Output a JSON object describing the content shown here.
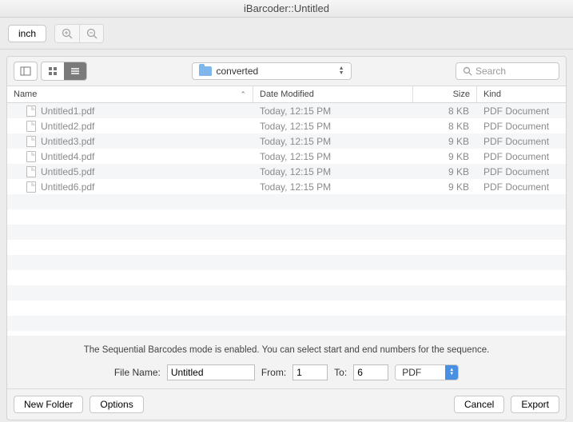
{
  "title": "iBarcoder::Untitled",
  "toolbar": {
    "unit_label": "inch"
  },
  "nav": {
    "folder": "converted",
    "search_placeholder": "Search"
  },
  "columns": {
    "name": "Name",
    "date": "Date Modified",
    "size": "Size",
    "kind": "Kind"
  },
  "files": [
    {
      "name": "Untitled1.pdf",
      "date": "Today, 12:15 PM",
      "size": "8 KB",
      "kind": "PDF Document"
    },
    {
      "name": "Untitled2.pdf",
      "date": "Today, 12:15 PM",
      "size": "8 KB",
      "kind": "PDF Document"
    },
    {
      "name": "Untitled3.pdf",
      "date": "Today, 12:15 PM",
      "size": "9 KB",
      "kind": "PDF Document"
    },
    {
      "name": "Untitled4.pdf",
      "date": "Today, 12:15 PM",
      "size": "9 KB",
      "kind": "PDF Document"
    },
    {
      "name": "Untitled5.pdf",
      "date": "Today, 12:15 PM",
      "size": "9 KB",
      "kind": "PDF Document"
    },
    {
      "name": "Untitled6.pdf",
      "date": "Today, 12:15 PM",
      "size": "9 KB",
      "kind": "PDF Document"
    }
  ],
  "message": "The Sequential Barcodes mode is enabled. You can select start and end numbers for the sequence.",
  "form": {
    "filename_label": "File Name:",
    "filename_value": "Untitled",
    "from_label": "From:",
    "from_value": "1",
    "to_label": "To:",
    "to_value": "6",
    "format": "PDF"
  },
  "footer": {
    "new_folder": "New Folder",
    "options": "Options",
    "cancel": "Cancel",
    "export": "Export"
  }
}
